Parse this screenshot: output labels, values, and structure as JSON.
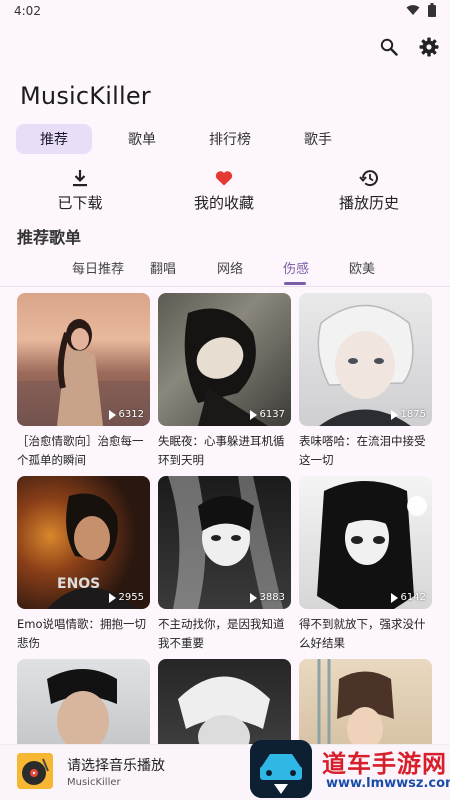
{
  "status_bar": {
    "time": "4:02",
    "wifi_icon": "wifi-icon",
    "battery_icon": "battery-icon"
  },
  "top_actions": {
    "search_icon": "search-icon",
    "settings_icon": "gear-icon"
  },
  "app": {
    "title": "MusicKiller"
  },
  "main_tabs": [
    {
      "label": "推荐",
      "active": true
    },
    {
      "label": "歌单",
      "active": false
    },
    {
      "label": "排行榜",
      "active": false
    },
    {
      "label": "歌手",
      "active": false
    }
  ],
  "quick_actions": [
    {
      "label": "已下载",
      "icon": "download-icon"
    },
    {
      "label": "我的收藏",
      "icon": "heart-icon",
      "color": "#e53935"
    },
    {
      "label": "播放历史",
      "icon": "history-icon"
    }
  ],
  "section": {
    "title": "推荐歌单"
  },
  "sub_tabs": [
    {
      "label": "每日推荐",
      "active": false
    },
    {
      "label": "翻唱",
      "active": false
    },
    {
      "label": "网络",
      "active": false
    },
    {
      "label": "伤感",
      "active": true
    },
    {
      "label": "欧美",
      "active": false
    }
  ],
  "playlists": [
    {
      "title": "［治愈情歌向］治愈每一个孤单的瞬间",
      "plays": "6312"
    },
    {
      "title": "失眠夜：心事躲进耳机循环到天明",
      "plays": "6137"
    },
    {
      "title": "表味嗒哈：在流泪中接受这一切",
      "plays": "1875"
    },
    {
      "title": "Emo说唱情歌：拥抱一切悲伤",
      "plays": "2955"
    },
    {
      "title": "不主动找你，是因我知道我不重要",
      "plays": "3883"
    },
    {
      "title": "得不到就放下，强求没什么好结果",
      "plays": "6142"
    },
    {
      "title": "",
      "plays": ""
    },
    {
      "title": "",
      "plays": ""
    },
    {
      "title": "",
      "plays": ""
    }
  ],
  "mini_player": {
    "title": "请选择音乐播放",
    "subtitle": "MusicKiller"
  },
  "watermark": {
    "text": "道车手游网",
    "url": "www.lmwwsz.com"
  },
  "colors": {
    "accent": "#7b5ea7",
    "tab_active_bg": "#e8def8",
    "heart": "#e53935",
    "background": "#fdf7fd"
  }
}
